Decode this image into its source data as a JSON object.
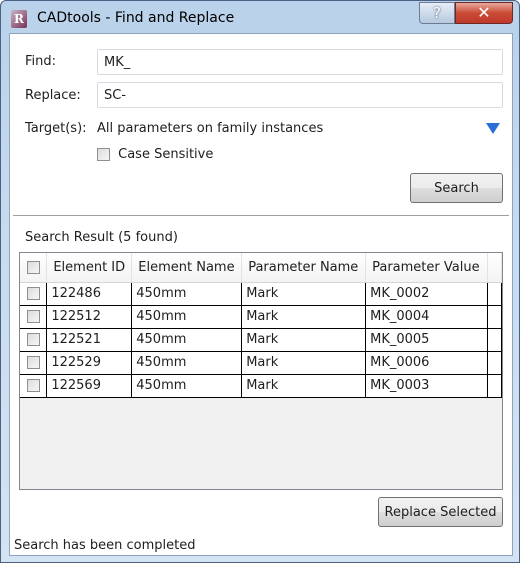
{
  "window": {
    "title": "CADtools - Find and Replace",
    "help_label": "?",
    "close_label": "✕"
  },
  "form": {
    "find_label": "Find:",
    "find_value": "MK_",
    "replace_label": "Replace:",
    "replace_value": "SC-",
    "targets_label": "Target(s):",
    "targets_value": "All parameters on family instances",
    "case_sensitive_label": "Case Sensitive",
    "case_sensitive_checked": false,
    "search_button": "Search"
  },
  "results": {
    "heading": "Search Result (5 found)",
    "columns": [
      "Element ID",
      "Element Name",
      "Parameter Name",
      "Parameter Value"
    ],
    "rows": [
      {
        "id": "122486",
        "name": "450mm",
        "param": "Mark",
        "value": "MK_0002"
      },
      {
        "id": "122512",
        "name": "450mm",
        "param": "Mark",
        "value": "MK_0004"
      },
      {
        "id": "122521",
        "name": "450mm",
        "param": "Mark",
        "value": "MK_0005"
      },
      {
        "id": "122529",
        "name": "450mm",
        "param": "Mark",
        "value": "MK_0006"
      },
      {
        "id": "122569",
        "name": "450mm",
        "param": "Mark",
        "value": "MK_0003"
      }
    ]
  },
  "replace_button": "Replace Selected",
  "status": "Search has been completed"
}
